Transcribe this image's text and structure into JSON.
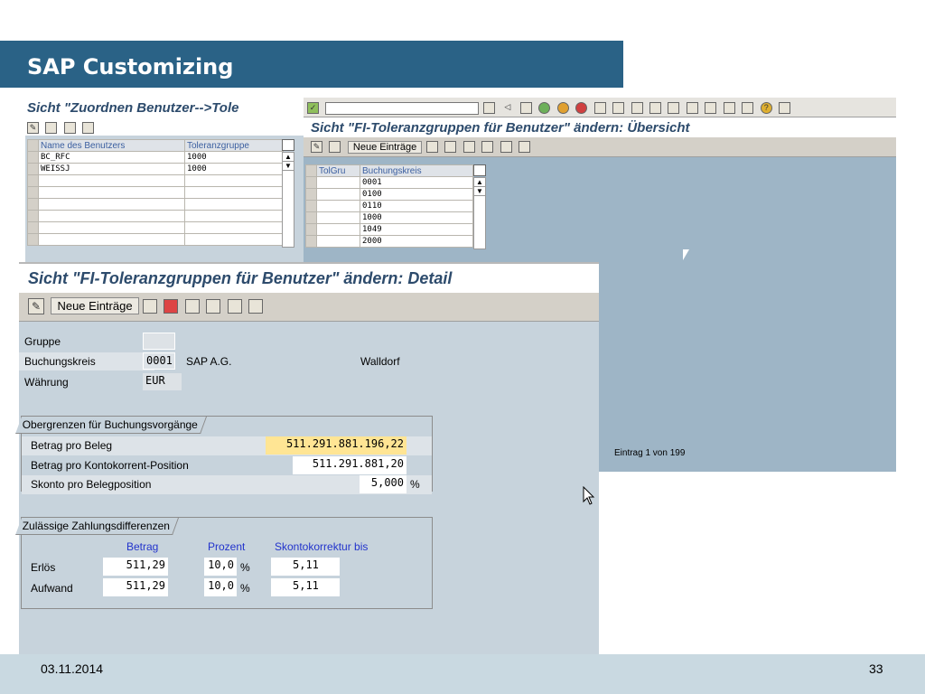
{
  "slide": {
    "title": "SAP Customizing",
    "date": "03.11.2014",
    "page_number": "33"
  },
  "win1": {
    "title": "Sicht \"Zuordnen Benutzer-->Tole",
    "columns": [
      "Name des Benutzers",
      "Toleranzgruppe"
    ],
    "rows": [
      {
        "user": "BC_RFC",
        "group": "1000"
      },
      {
        "user": "WEISSJ",
        "group": "1000"
      }
    ]
  },
  "win2": {
    "title": "Sicht \"FI-Toleranzgruppen für Benutzer\" ändern: Übersicht",
    "new_entries": "Neue Einträge",
    "columns": [
      "TolGru",
      "Buchungskreis"
    ],
    "rows": [
      "0001",
      "0100",
      "0110",
      "1000",
      "1049",
      "2000"
    ],
    "status": "Eintrag 1 von 199"
  },
  "detail": {
    "title": "Sicht \"FI-Toleranzgruppen für Benutzer\" ändern: Detail",
    "new_entries": "Neue Einträge",
    "gruppe_label": "Gruppe",
    "gruppe_value": "",
    "bukrs_label": "Buchungskreis",
    "bukrs_value": "0001",
    "company": "SAP A.G.",
    "city": "Walldorf",
    "currency_label": "Währung",
    "currency_value": "EUR",
    "upper": {
      "caption": "Obergrenzen für Buchungsvorgänge",
      "beleg_label": "Betrag pro Beleg",
      "beleg_value": "511.291.881.196,22",
      "konto_label": "Betrag pro Kontokorrent-Position",
      "konto_value": "511.291.881,20",
      "skonto_label": "Skonto pro Belegposition",
      "skonto_value": "5,000",
      "pct": "%"
    },
    "diff": {
      "caption": "Zulässige Zahlungsdifferenzen",
      "h_betrag": "Betrag",
      "h_prozent": "Prozent",
      "h_skonto": "Skontokorrektur bis",
      "erloes_label": "Erlös",
      "erloes_betrag": "511,29",
      "erloes_prozent": "10,0",
      "erloes_skonto": "5,11",
      "aufwand_label": "Aufwand",
      "aufwand_betrag": "511,29",
      "aufwand_prozent": "10,0",
      "aufwand_skonto": "5,11",
      "pct": "%"
    }
  }
}
